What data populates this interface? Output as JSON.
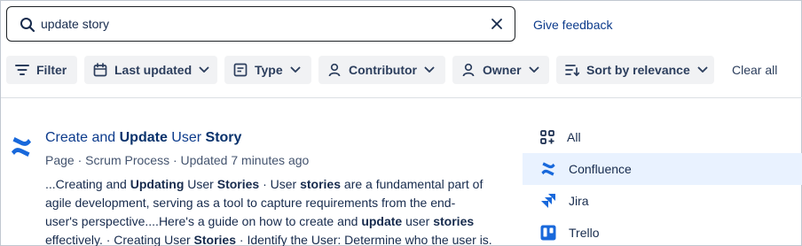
{
  "search": {
    "value": "update story",
    "feedback_label": "Give feedback"
  },
  "filters": {
    "filter_label": "Filter",
    "last_updated_label": "Last updated",
    "type_label": "Type",
    "contributor_label": "Contributor",
    "owner_label": "Owner",
    "sort_label": "Sort by relevance",
    "clear_all_label": "Clear all"
  },
  "result": {
    "title_parts": [
      "Create and ",
      "Update",
      " User ",
      "Story"
    ],
    "meta": {
      "type": "Page",
      "space": "Scrum Process",
      "updated": "Updated 7 minutes ago"
    },
    "snippet_lines": [
      [
        {
          "t": "...Creating and ",
          "b": false
        },
        {
          "t": "Updating",
          "b": true
        },
        {
          "t": " User ",
          "b": false
        },
        {
          "t": "Stories",
          "b": true
        },
        {
          "t": " · User ",
          "b": false
        },
        {
          "t": "stories",
          "b": true
        },
        {
          "t": " are a fundamental part of",
          "b": false
        }
      ],
      [
        {
          "t": "agile development, serving as a tool to capture requirements from the end-",
          "b": false
        }
      ],
      [
        {
          "t": "user's perspective....Here's a guide on how to create and ",
          "b": false
        },
        {
          "t": "update",
          "b": true
        },
        {
          "t": " user ",
          "b": false
        },
        {
          "t": "stories",
          "b": true
        }
      ],
      [
        {
          "t": "effectively. · Creating User ",
          "b": false
        },
        {
          "t": "Stories",
          "b": true
        },
        {
          "t": " · Identify the User: Determine who the user is.",
          "b": false
        }
      ]
    ]
  },
  "products": [
    {
      "label": "All",
      "icon": "apps-icon",
      "selected": false
    },
    {
      "label": "Confluence",
      "icon": "confluence-icon",
      "selected": true
    },
    {
      "label": "Jira",
      "icon": "jira-icon",
      "selected": false
    },
    {
      "label": "Trello",
      "icon": "trello-icon",
      "selected": false
    }
  ],
  "colors": {
    "link": "#0c3b8c",
    "selected_bg": "#e9f2ff",
    "chip_bg": "#f1f2f4",
    "confluence_blue": "#1868db"
  }
}
